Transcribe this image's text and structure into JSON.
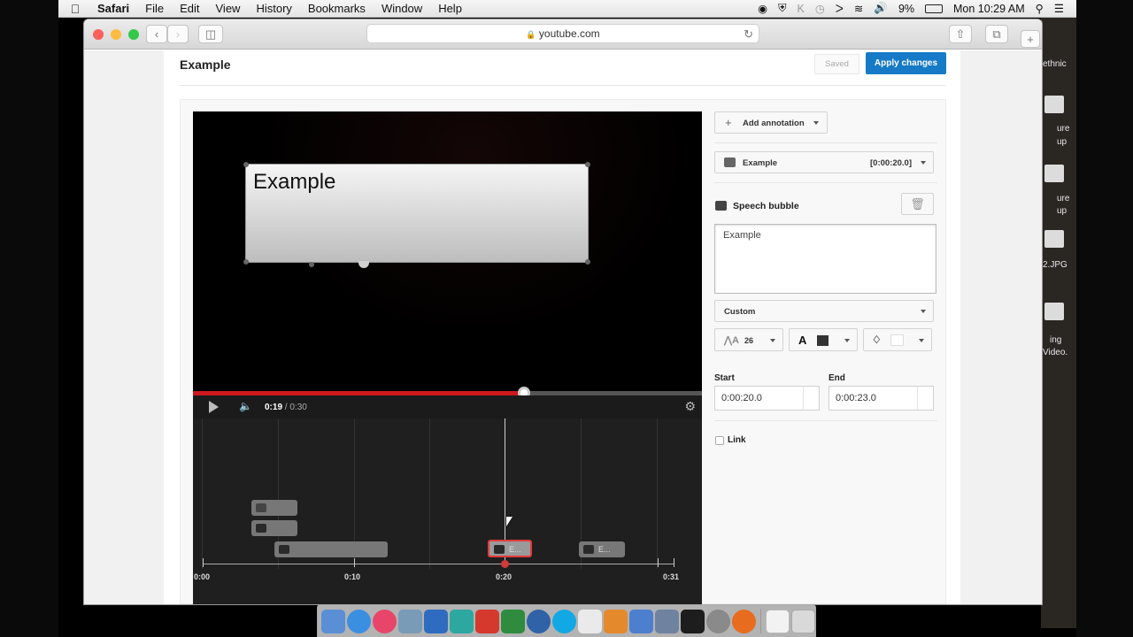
{
  "menubar": {
    "app": "Safari",
    "items": [
      "File",
      "Edit",
      "View",
      "History",
      "Bookmarks",
      "Window",
      "Help"
    ],
    "battery": "9%",
    "clock": "Mon 10:29 AM"
  },
  "browser": {
    "url": "youtube.com"
  },
  "editor": {
    "title": "Example",
    "saved_label": "Saved",
    "apply_label": "Apply changes"
  },
  "video": {
    "annotation_text": "Example",
    "current_time": "0:19",
    "duration": "/ 0:30",
    "progress": 0.65
  },
  "timeline": {
    "labels": [
      "0:00",
      "0:10",
      "0:20",
      "0:31"
    ],
    "selected_clip_label": "E...",
    "clip_label": "E..."
  },
  "panel": {
    "add_annotation": "Add annotation",
    "annotation_select": {
      "name": "Example",
      "time": "[0:00:20.0]"
    },
    "type_label": "Speech bubble",
    "text_value": "Example",
    "style_select": "Custom",
    "font_size": "26",
    "start_label": "Start",
    "start_value": "0:00:20.0",
    "end_label": "End",
    "end_value": "0:00:23.0",
    "link_label": "Link"
  },
  "desktop": {
    "labels": [
      "ethnic",
      "ure",
      "up",
      "ure",
      "up",
      "2.JPG",
      "ing",
      "Video."
    ]
  },
  "colors": {
    "apply_blue": "#167ac6",
    "progress_red": "#cc181e"
  }
}
